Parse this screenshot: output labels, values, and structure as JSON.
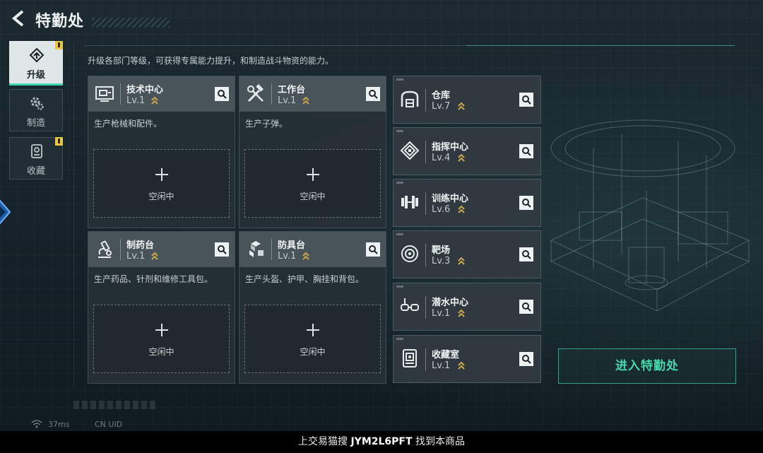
{
  "header": {
    "title": "特勤处"
  },
  "sidebar": {
    "tabs": [
      {
        "label": "升级",
        "active": true,
        "badge": true,
        "icon": "upgrade-icon"
      },
      {
        "label": "制造",
        "active": false,
        "badge": false,
        "icon": "gear-icon"
      },
      {
        "label": "收藏",
        "active": false,
        "badge": true,
        "icon": "collection-icon"
      }
    ]
  },
  "description": "升级各部门等级，可获得专属能力提升，和制造战斗物资的能力。",
  "production_cards": [
    {
      "name": "技术中心",
      "level": "Lv.1",
      "desc": "生产枪械和配件。",
      "slot_label": "空闲中",
      "icon": "tech-center-icon"
    },
    {
      "name": "工作台",
      "level": "Lv.1",
      "desc": "生产子弹。",
      "slot_label": "空闲中",
      "icon": "workbench-tools-icon"
    },
    {
      "name": "制药台",
      "level": "Lv.1",
      "desc": "生产药品、针剂和维修工具包。",
      "slot_label": "空闲中",
      "icon": "microscope-icon"
    },
    {
      "name": "防具台",
      "level": "Lv.1",
      "desc": "生产头盔、护甲、胸挂和背包。",
      "slot_label": "空闲中",
      "icon": "armor-cubes-icon"
    }
  ],
  "facilities": [
    {
      "name": "仓库",
      "level": "Lv.7",
      "icon": "warehouse-icon"
    },
    {
      "name": "指挥中心",
      "level": "Lv.4",
      "icon": "command-center-icon"
    },
    {
      "name": "训练中心",
      "level": "Lv.6",
      "icon": "dumbbell-icon"
    },
    {
      "name": "靶场",
      "level": "Lv.3",
      "icon": "target-icon"
    },
    {
      "name": "潜水中心",
      "level": "Lv.1",
      "icon": "diving-goggles-icon"
    },
    {
      "name": "收藏室",
      "level": "Lv.1",
      "icon": "collection-room-icon"
    }
  ],
  "enter_button": "进入特勤处",
  "status": {
    "ping": "37ms",
    "region": "CN UID"
  },
  "watermark": {
    "prefix": "上交易猫搜 ",
    "code": "JYM2L6PFT",
    "suffix": " 找到本商品"
  },
  "colors": {
    "accent": "#45d9ae",
    "badge": "#e8c64a",
    "level_arrow": "#c9a94a"
  }
}
